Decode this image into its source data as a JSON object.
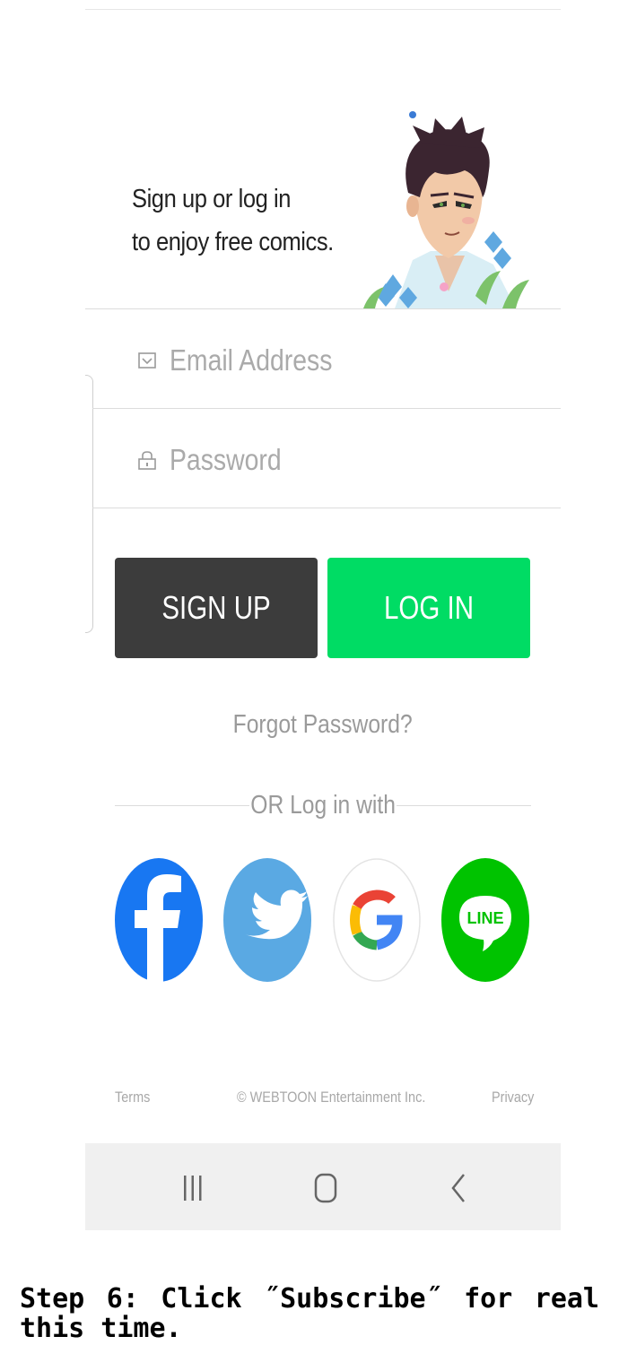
{
  "promo": {
    "line1": "Sign up or log in",
    "line2": "to enjoy free comics."
  },
  "form": {
    "email_placeholder": "Email Address",
    "password_placeholder": "Password",
    "email_icon": "envelope-icon",
    "password_icon": "lock-icon"
  },
  "buttons": {
    "signup_label": "SIGN UP",
    "login_label": "LOG IN"
  },
  "forgot_label": "Forgot Password?",
  "social": {
    "divider_label": "OR Log in with",
    "providers": [
      {
        "name": "facebook",
        "icon": "facebook-icon",
        "color": "#1877f2"
      },
      {
        "name": "twitter",
        "icon": "twitter-icon",
        "color": "#5aa9e3"
      },
      {
        "name": "google",
        "icon": "google-icon",
        "color": "#ffffff"
      },
      {
        "name": "line",
        "icon": "line-icon",
        "color": "#00c300",
        "label": "LINE"
      }
    ]
  },
  "footer": {
    "terms": "Terms",
    "copyright": "© WEBTOON Entertainment Inc.",
    "privacy": "Privacy"
  },
  "navbar": {
    "icons": [
      "recent-apps-icon",
      "home-icon",
      "back-icon"
    ]
  },
  "colors": {
    "signup_bg": "#3c3c3c",
    "login_bg": "#00dc64",
    "navbar_bg": "#f0f0f0"
  },
  "caption": "Step 6: Click ˝Subscribe˝ for real this time."
}
